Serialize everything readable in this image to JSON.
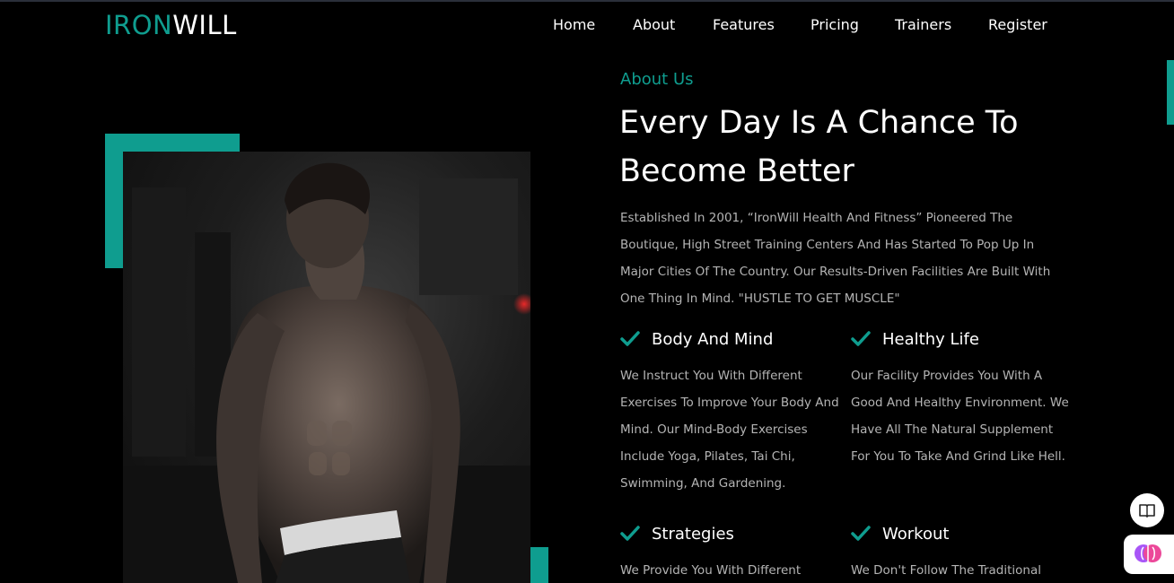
{
  "header": {
    "logo_part1": "IRON",
    "logo_part2": "WILL",
    "nav": [
      "Home",
      "About",
      "Features",
      "Pricing",
      "Trainers",
      "Register"
    ]
  },
  "about": {
    "eyebrow": "About Us",
    "title": "Every Day Is A Chance To Become Better",
    "lead": "Established In 2001, “IronWill Health And Fitness” Pioneered The Boutique, High Street Training Centers And Has Started To Pop Up In Major Cities Of The Country. Our Results-Driven Facilities Are Built With One Thing In Mind. \"HUSTLE TO GET MUSCLE\""
  },
  "features": [
    {
      "title": "Body And Mind",
      "desc": "We Instruct You With Different Exercises To Improve Your Body And Mind. Our Mind-Body Exercises Include Yoga, Pilates, Tai Chi, Swimming, And Gardening."
    },
    {
      "title": "Healthy Life",
      "desc": "Our Facility Provides You With A Good And Healthy Environment. We Have All The Natural Supplement For You To Take And Grind Like Hell."
    },
    {
      "title": "Strategies",
      "desc": "We Provide You With Different"
    },
    {
      "title": "Workout",
      "desc": "We Don't Follow The Traditional"
    }
  ],
  "icons": {
    "feature": "check-icon",
    "widget_top": "book-icon",
    "widget_bottom": "brain-icon"
  },
  "colors": {
    "accent": "#0f9d8f",
    "background": "#000000",
    "text": "#ffffff",
    "muted": "#b4b4b4"
  }
}
